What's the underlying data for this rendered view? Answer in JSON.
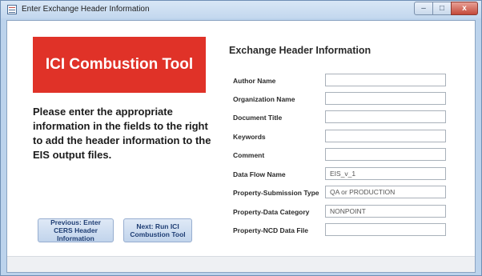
{
  "window": {
    "title": "Enter Exchange Header Information",
    "controls": {
      "minimize": "–",
      "maximize": "□",
      "close": "x"
    }
  },
  "left_panel": {
    "banner_title": "ICI Combustion Tool",
    "instructions": "Please enter the appropriate information in the fields to the right to add the header information to the EIS output files.",
    "previous_button": "Previous: Enter CERS Header Information",
    "next_button": "Next: Run ICI Combustion Tool"
  },
  "form": {
    "heading": "Exchange Header Information",
    "fields": [
      {
        "label": "Author Name",
        "value": ""
      },
      {
        "label": "Organization Name",
        "value": ""
      },
      {
        "label": "Document Title",
        "value": ""
      },
      {
        "label": "Keywords",
        "value": ""
      },
      {
        "label": "Comment",
        "value": ""
      },
      {
        "label": "Data Flow Name",
        "value": "EIS_v_1"
      },
      {
        "label": "Property-Submission Type",
        "value": "QA or PRODUCTION"
      },
      {
        "label": "Property-Data Category",
        "value": "NONPOINT"
      },
      {
        "label": "Property-NCD Data File",
        "value": ""
      }
    ]
  }
}
